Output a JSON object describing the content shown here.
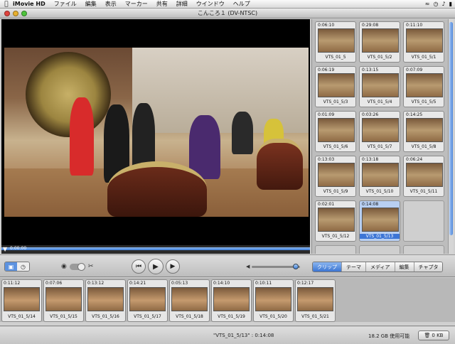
{
  "menubar": {
    "app": "iMovie HD",
    "items": [
      "ファイル",
      "編集",
      "表示",
      "マーカー",
      "共有",
      "詳細",
      "ウインドウ",
      "ヘルプ"
    ]
  },
  "window": {
    "title": "こんころ１ (DV-NTSC)"
  },
  "scrubber": {
    "timecode": "0:00:00"
  },
  "clips": [
    {
      "duration": "0:06:10",
      "name": "VTS_01_5"
    },
    {
      "duration": "0:29:08",
      "name": "VTS_01_5/2"
    },
    {
      "duration": "0:11:10",
      "name": "VTS_01_5/1"
    },
    {
      "duration": "0:06:19",
      "name": "VTS_01_5/3"
    },
    {
      "duration": "0:13:15",
      "name": "VTS_01_5/4"
    },
    {
      "duration": "0:07:09",
      "name": "VTS_01_5/5"
    },
    {
      "duration": "0:01:09",
      "name": "VTS_01_5/6"
    },
    {
      "duration": "0:03:26",
      "name": "VTS_01_5/7"
    },
    {
      "duration": "0:14:25",
      "name": "VTS_01_5/8"
    },
    {
      "duration": "0:13:03",
      "name": "VTS_01_5/9"
    },
    {
      "duration": "0:13:18",
      "name": "VTS_01_5/10"
    },
    {
      "duration": "0:06:24",
      "name": "VTS_01_5/11"
    },
    {
      "duration": "0:02:01",
      "name": "VTS_01_5/12"
    },
    {
      "duration": "0:14:08",
      "name": "VTS_01_5/13",
      "selected": true
    }
  ],
  "tabs": [
    "クリップ",
    "テーマ",
    "メディア",
    "編集",
    "チャプタ"
  ],
  "active_tab": "クリップ",
  "timeline": [
    {
      "duration": "0:11:12",
      "name": "VTS_01_5/14"
    },
    {
      "duration": "0:07:06",
      "name": "VTS_01_5/15"
    },
    {
      "duration": "0:13:12",
      "name": "VTS_01_5/16"
    },
    {
      "duration": "0:14:21",
      "name": "VTS_01_5/17"
    },
    {
      "duration": "0:05:13",
      "name": "VTS_01_5/18"
    },
    {
      "duration": "0:14:10",
      "name": "VTS_01_5/19"
    },
    {
      "duration": "0:10:11",
      "name": "VTS_01_5/20"
    },
    {
      "duration": "0:12:17",
      "name": "VTS_01_5/21"
    }
  ],
  "status": {
    "selected_clip": "\"VTS_01_5/13\" : 0:14:08",
    "free_space": "18.2 GB 使用可能",
    "trash": "0 KB"
  },
  "colors": {
    "accent": "#3b75d2",
    "selected_clip": "#b8cff2"
  }
}
